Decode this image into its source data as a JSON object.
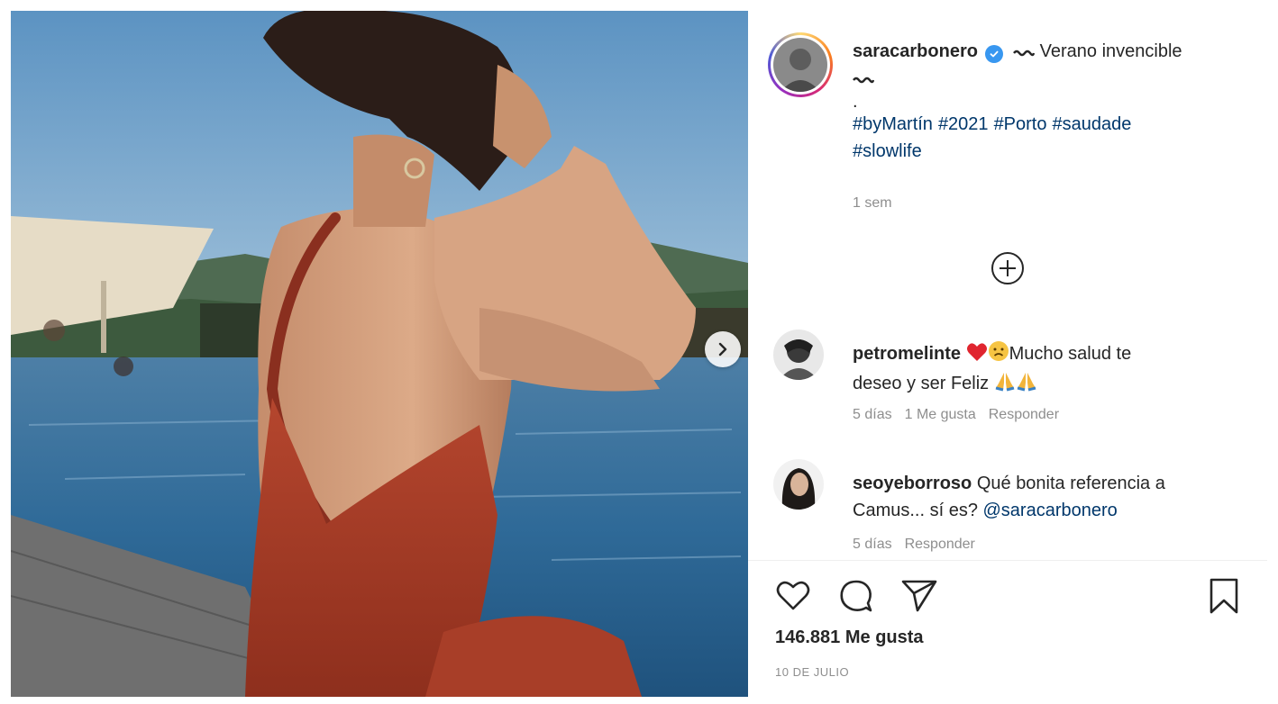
{
  "post": {
    "author": "saracarbonero",
    "caption": "Verano invencible",
    "caption_dot": ".",
    "hashtags": [
      "#byMartín",
      "#2021",
      "#Porto",
      "#saudade",
      "#slowlife"
    ],
    "age": "1 sem"
  },
  "comments": [
    {
      "username": "petromelinte",
      "text_after_emoji": "Mucho salud te",
      "text_line2": "deseo y ser Feliz",
      "age": "5 días",
      "likes": "1 Me gusta",
      "reply": "Responder"
    },
    {
      "username": "seoyeborroso",
      "text": "Qué bonita referencia a",
      "text_line2": "Camus... sí es?",
      "mention": "@saracarbonero",
      "age": "5 días",
      "reply": "Responder"
    }
  ],
  "footer": {
    "likes": "146.881 Me gusta",
    "date": "10 DE JULIO"
  },
  "icons": {
    "verified": "verified-badge-icon",
    "like": "heart-icon",
    "comment": "comment-bubble-icon",
    "share": "paper-plane-icon",
    "save": "bookmark-icon",
    "load_more": "plus-circle-icon",
    "next": "chevron-right-icon"
  },
  "colors": {
    "link": "#00376b",
    "verified": "#3897f0",
    "muted": "#8e8e8e",
    "swimsuit": "#b5462e"
  }
}
